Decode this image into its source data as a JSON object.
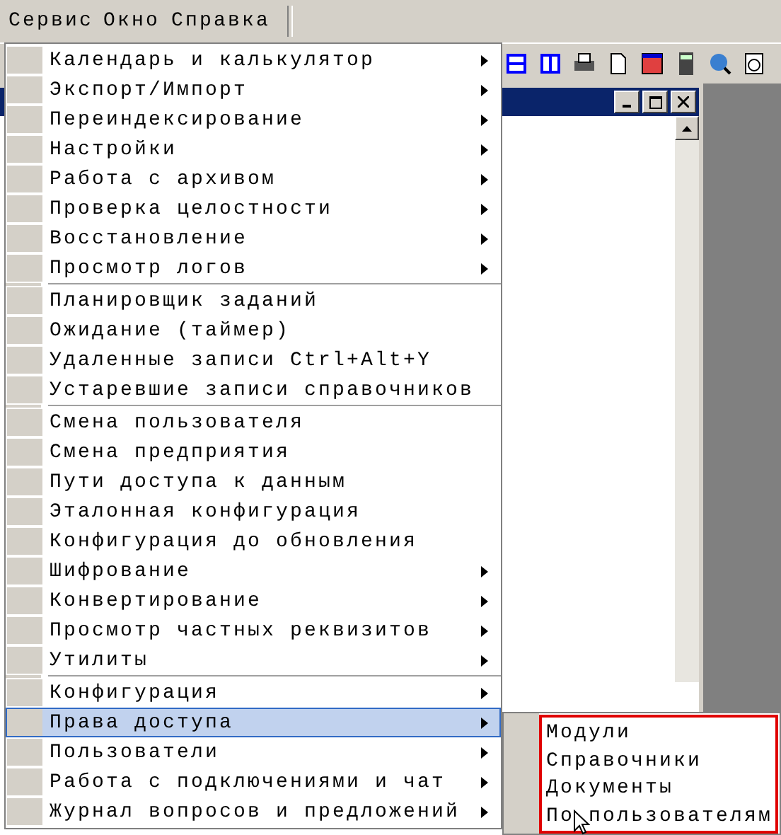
{
  "menubar": [
    {
      "label": "Сервис",
      "selected": true
    },
    {
      "label": "Окно",
      "selected": false
    },
    {
      "label": "Справка",
      "selected": false
    }
  ],
  "menu": {
    "groups": [
      [
        {
          "label": "Календарь и калькулятор",
          "submenu": true,
          "selected": false
        },
        {
          "label": "Экспорт/Импорт",
          "submenu": true,
          "selected": false
        },
        {
          "label": "Переиндексирование",
          "submenu": true,
          "selected": false
        },
        {
          "label": "Настройки",
          "submenu": true,
          "selected": false
        },
        {
          "label": "Работа с архивом",
          "submenu": true,
          "selected": false
        },
        {
          "label": "Проверка целостности",
          "submenu": true,
          "selected": false
        },
        {
          "label": "Восстановление",
          "submenu": true,
          "selected": false
        },
        {
          "label": "Просмотр логов",
          "submenu": true,
          "selected": false
        }
      ],
      [
        {
          "label": "Планировщик заданий",
          "submenu": false,
          "selected": false
        },
        {
          "label": "Ожидание (таймер)",
          "submenu": false,
          "selected": false
        },
        {
          "label": "Удаленные записи Ctrl+Alt+Y",
          "submenu": false,
          "selected": false
        },
        {
          "label": "Устаревшие записи справочников",
          "submenu": false,
          "selected": false
        }
      ],
      [
        {
          "label": "Смена пользователя",
          "submenu": false,
          "selected": false
        },
        {
          "label": "Смена предприятия",
          "submenu": false,
          "selected": false
        },
        {
          "label": "Пути доступа к данным",
          "submenu": false,
          "selected": false
        },
        {
          "label": "Эталонная конфигурация",
          "submenu": false,
          "selected": false
        },
        {
          "label": "Конфигурация до обновления",
          "submenu": false,
          "selected": false
        },
        {
          "label": "Шифрование",
          "submenu": true,
          "selected": false
        },
        {
          "label": "Конвертирование",
          "submenu": true,
          "selected": false
        },
        {
          "label": "Просмотр частных реквизитов",
          "submenu": true,
          "selected": false
        },
        {
          "label": "Утилиты",
          "submenu": true,
          "selected": false
        }
      ],
      [
        {
          "label": "Конфигурация",
          "submenu": true,
          "selected": false
        },
        {
          "label": "Права доступа",
          "submenu": true,
          "selected": true
        },
        {
          "label": "Пользователи",
          "submenu": true,
          "selected": false
        },
        {
          "label": "Работа с подключениями и чат",
          "submenu": true,
          "selected": false
        },
        {
          "label": "Журнал вопросов и предложений",
          "submenu": true,
          "selected": false
        }
      ]
    ]
  },
  "submenu": {
    "items": [
      {
        "label": "Модули"
      },
      {
        "label": "Справочники"
      },
      {
        "label": "Документы"
      },
      {
        "label": "По пользователям"
      }
    ]
  }
}
